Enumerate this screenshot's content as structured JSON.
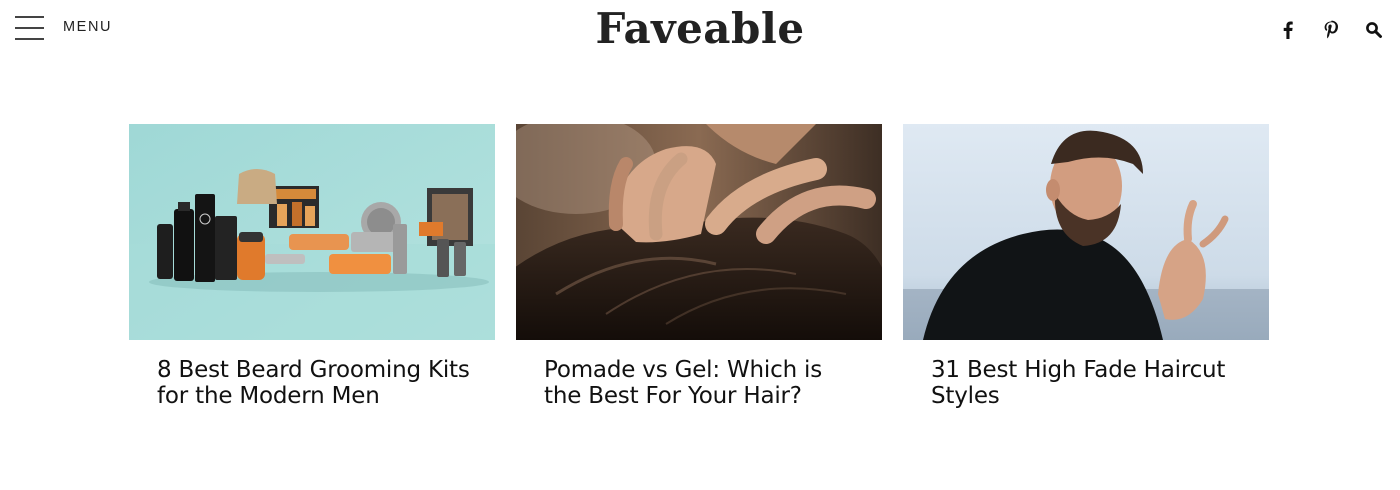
{
  "header": {
    "menu_label": "MENU",
    "logo_text": "Faveable",
    "icons": [
      "facebook-icon",
      "pinterest-icon",
      "search-icon"
    ]
  },
  "articles": [
    {
      "title": "8 Best Beard Grooming Kits for the Modern Men",
      "image": "beard-grooming-kit-products-photo"
    },
    {
      "title": "Pomade vs Gel: Which is the Best For Your Hair?",
      "image": "hands-in-dark-hair-photo"
    },
    {
      "title": "31 Best High Fade Haircut Styles",
      "image": "bearded-man-high-fade-haircut-photo"
    }
  ],
  "colors": {
    "text": "#1a1a1a",
    "background": "#ffffff",
    "card1_bg": "#a9dcd8"
  }
}
